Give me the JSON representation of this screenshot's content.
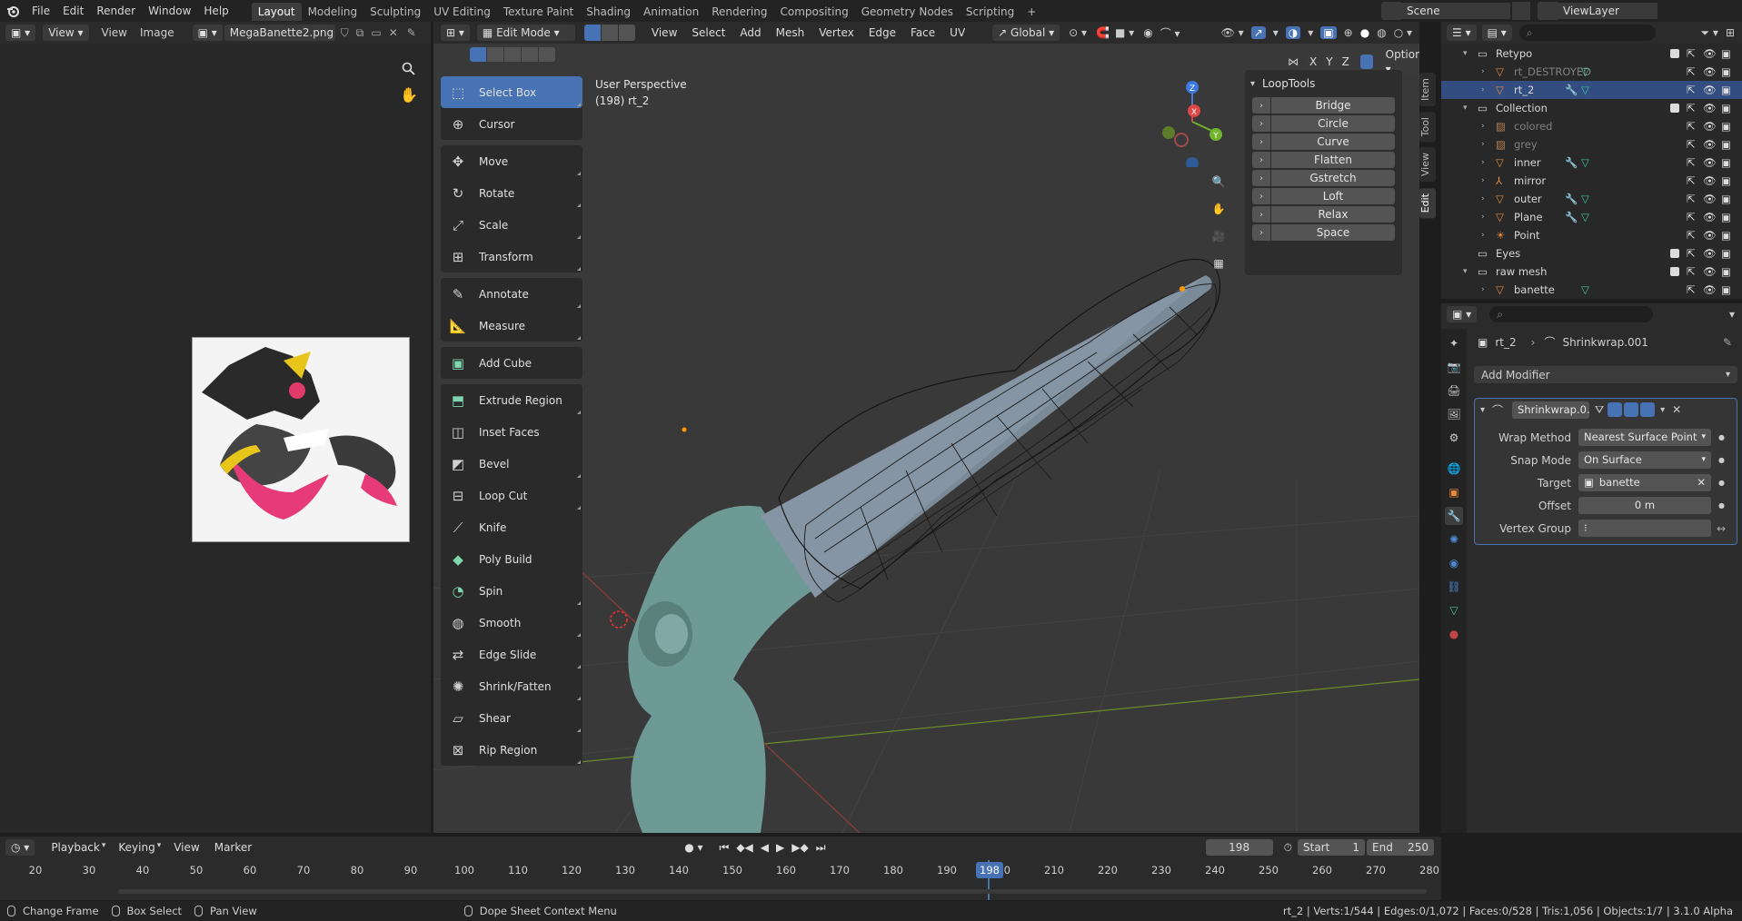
{
  "topbar": {
    "menus": [
      "File",
      "Edit",
      "Render",
      "Window",
      "Help"
    ],
    "workspaces": [
      "Layout",
      "Modeling",
      "Sculpting",
      "UV Editing",
      "Texture Paint",
      "Shading",
      "Animation",
      "Rendering",
      "Compositing",
      "Geometry Nodes",
      "Scripting"
    ],
    "active_workspace": "Layout",
    "add_workspace": "+",
    "scene": "Scene",
    "view_layer": "ViewLayer"
  },
  "image_editor": {
    "mode": "View",
    "menus": [
      "View",
      "Image"
    ],
    "image_name": "MegaBanette2.png"
  },
  "viewport": {
    "mode": "Edit Mode",
    "menus": [
      "View",
      "Select",
      "Add",
      "Mesh",
      "Vertex",
      "Edge",
      "Face",
      "UV"
    ],
    "orientation": "Global",
    "overlay_title": "User Perspective",
    "overlay_subtitle": "(198) rt_2",
    "axis_labels": {
      "x": "X",
      "y": "Y",
      "z": "Z"
    },
    "options": "Options",
    "mirror_axes": [
      "X",
      "Y",
      "Z"
    ],
    "side_tabs": [
      "Item",
      "Tool",
      "View",
      "Edit"
    ]
  },
  "tools": [
    {
      "label": "Select Box",
      "icon": "select-box-icon",
      "selected": true
    },
    {
      "label": "Cursor",
      "icon": "cursor-icon"
    },
    {
      "label": "Move",
      "icon": "move-icon"
    },
    {
      "label": "Rotate",
      "icon": "rotate-icon"
    },
    {
      "label": "Scale",
      "icon": "scale-icon"
    },
    {
      "label": "Transform",
      "icon": "transform-icon"
    },
    {
      "label": "Annotate",
      "icon": "annotate-icon"
    },
    {
      "label": "Measure",
      "icon": "measure-icon"
    },
    {
      "label": "Add Cube",
      "icon": "add-cube-icon"
    },
    {
      "label": "Extrude Region",
      "icon": "extrude-icon"
    },
    {
      "label": "Inset Faces",
      "icon": "inset-icon"
    },
    {
      "label": "Bevel",
      "icon": "bevel-icon"
    },
    {
      "label": "Loop Cut",
      "icon": "loop-cut-icon"
    },
    {
      "label": "Knife",
      "icon": "knife-icon"
    },
    {
      "label": "Poly Build",
      "icon": "poly-build-icon"
    },
    {
      "label": "Spin",
      "icon": "spin-icon"
    },
    {
      "label": "Smooth",
      "icon": "smooth-icon"
    },
    {
      "label": "Edge Slide",
      "icon": "edge-slide-icon"
    },
    {
      "label": "Shrink/Fatten",
      "icon": "shrink-fatten-icon"
    },
    {
      "label": "Shear",
      "icon": "shear-icon"
    },
    {
      "label": "Rip Region",
      "icon": "rip-icon"
    }
  ],
  "looptools": {
    "title": "LoopTools",
    "buttons": [
      "Bridge",
      "Circle",
      "Curve",
      "Flatten",
      "Gstretch",
      "Loft",
      "Relax",
      "Space"
    ]
  },
  "outliner": {
    "rows": [
      {
        "name": "Retypo",
        "type": "collection",
        "indent": 1,
        "expanded": true,
        "check": true
      },
      {
        "name": "rt_DESTROYED",
        "type": "mesh",
        "indent": 2,
        "dim": true
      },
      {
        "name": "rt_2",
        "type": "mesh",
        "indent": 2,
        "selected": true
      },
      {
        "name": "Collection",
        "type": "collection",
        "indent": 1,
        "expanded": true,
        "check": true
      },
      {
        "name": "colored",
        "type": "image",
        "indent": 2,
        "dim": true
      },
      {
        "name": "grey",
        "type": "image",
        "indent": 2,
        "dim": true
      },
      {
        "name": "inner",
        "type": "mesh",
        "indent": 2
      },
      {
        "name": "mirror",
        "type": "empty",
        "indent": 2
      },
      {
        "name": "outer",
        "type": "mesh",
        "indent": 2
      },
      {
        "name": "Plane",
        "type": "mesh",
        "indent": 2
      },
      {
        "name": "Point",
        "type": "light",
        "indent": 2
      },
      {
        "name": "Eyes",
        "type": "collection",
        "indent": 1,
        "check": true
      },
      {
        "name": "raw mesh",
        "type": "collection",
        "indent": 1,
        "expanded": true,
        "check": true
      },
      {
        "name": "banette",
        "type": "mesh",
        "indent": 2
      }
    ]
  },
  "properties": {
    "breadcrumb_object": "rt_2",
    "breadcrumb_modifier": "Shrinkwrap.001",
    "add_modifier": "Add Modifier",
    "modifier_name": "Shrinkwrap.0...",
    "fields": [
      {
        "label": "Wrap Method",
        "value": "Nearest Surface Point",
        "kind": "dropdown"
      },
      {
        "label": "Snap Mode",
        "value": "On Surface",
        "kind": "dropdown"
      },
      {
        "label": "Target",
        "value": "banette",
        "kind": "object"
      },
      {
        "label": "Offset",
        "value": "0 m",
        "kind": "number"
      },
      {
        "label": "Vertex Group",
        "value": "",
        "kind": "group"
      }
    ]
  },
  "timeline": {
    "menus": [
      "Playback",
      "Keying",
      "View",
      "Marker"
    ],
    "current_frame": "198",
    "start_label": "Start",
    "start": "1",
    "end_label": "End",
    "end": "250",
    "ticks": [
      "20",
      "30",
      "40",
      "50",
      "60",
      "70",
      "80",
      "90",
      "100",
      "110",
      "120",
      "130",
      "140",
      "150",
      "160",
      "170",
      "180",
      "190",
      "200",
      "210",
      "220",
      "230",
      "240",
      "250",
      "260",
      "270",
      "280"
    ]
  },
  "statusbar": {
    "items": [
      "Change Frame",
      "Box Select",
      "Pan View",
      "Dope Sheet Context Menu"
    ],
    "stats": "rt_2 | Verts:1/544 | Edges:0/1,072 | Faces:0/528 | Tris:1,056 | Objects:1/7 | 3.1.0 Alpha"
  },
  "colors": {
    "accent": "#4772b3",
    "header": "#2b2b2b",
    "viewport_bg": "#393939",
    "playhead": "#4772b3"
  }
}
